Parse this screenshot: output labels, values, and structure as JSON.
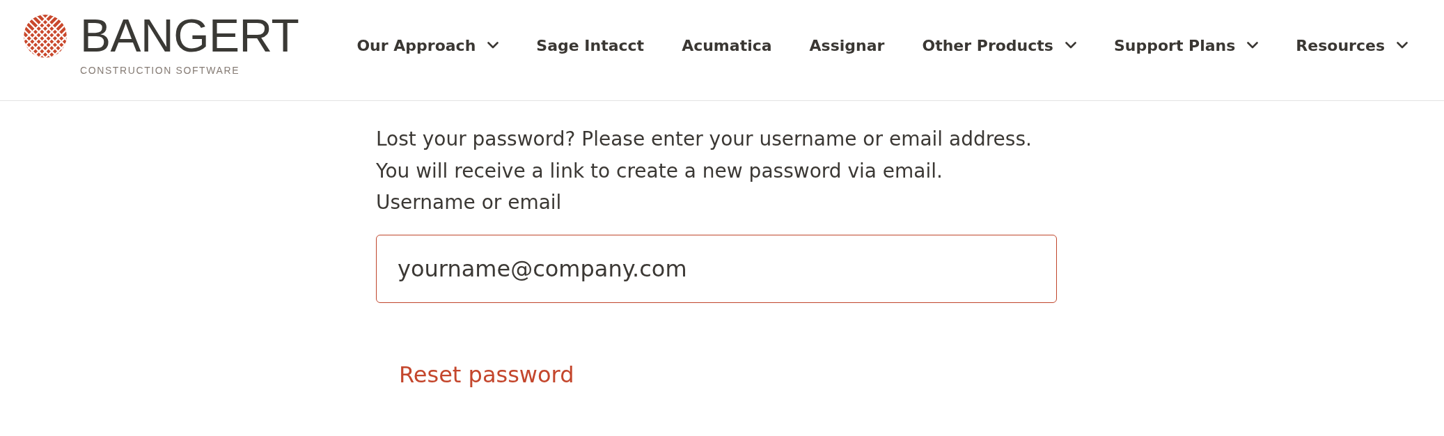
{
  "header": {
    "logo": {
      "wordmark": "BANGERT",
      "tagline": "CONSTRUCTION SOFTWARE"
    },
    "nav": [
      {
        "label": "Our Approach",
        "dropdown": true
      },
      {
        "label": "Sage Intacct",
        "dropdown": false
      },
      {
        "label": "Acumatica",
        "dropdown": false
      },
      {
        "label": "Assignar",
        "dropdown": false
      },
      {
        "label": "Other Products",
        "dropdown": true
      },
      {
        "label": "Support Plans",
        "dropdown": true
      },
      {
        "label": "Resources",
        "dropdown": true
      }
    ]
  },
  "form": {
    "intro": [
      "Lost your password? Please enter your username or email address.",
      "You will receive a link to create a new password via email."
    ],
    "field": {
      "label": "Username or email",
      "placeholder": "yourname@company.com"
    },
    "submit": "Reset password"
  }
}
